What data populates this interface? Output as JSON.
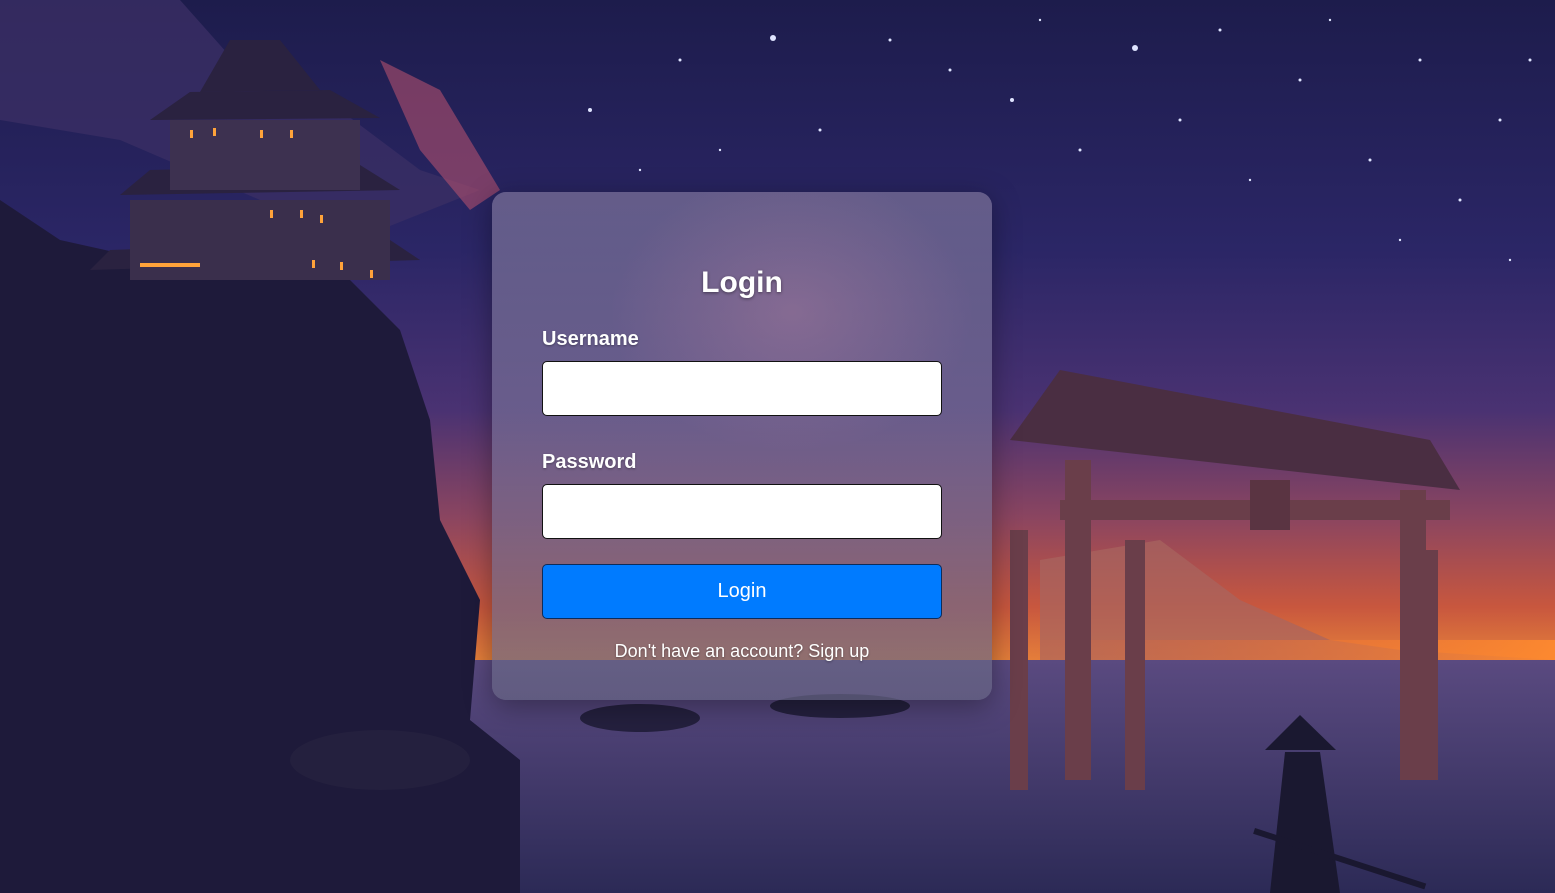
{
  "login": {
    "title": "Login",
    "username_label": "Username",
    "username_value": "",
    "password_label": "Password",
    "password_value": "",
    "submit_label": "Login",
    "signup_prompt": "Don't have an account?",
    "signup_link": "Sign up"
  },
  "theme": {
    "button_color": "#007bff",
    "card_text_color": "#ffffff",
    "background_description_icon": "night-castle-torii-landscape"
  }
}
